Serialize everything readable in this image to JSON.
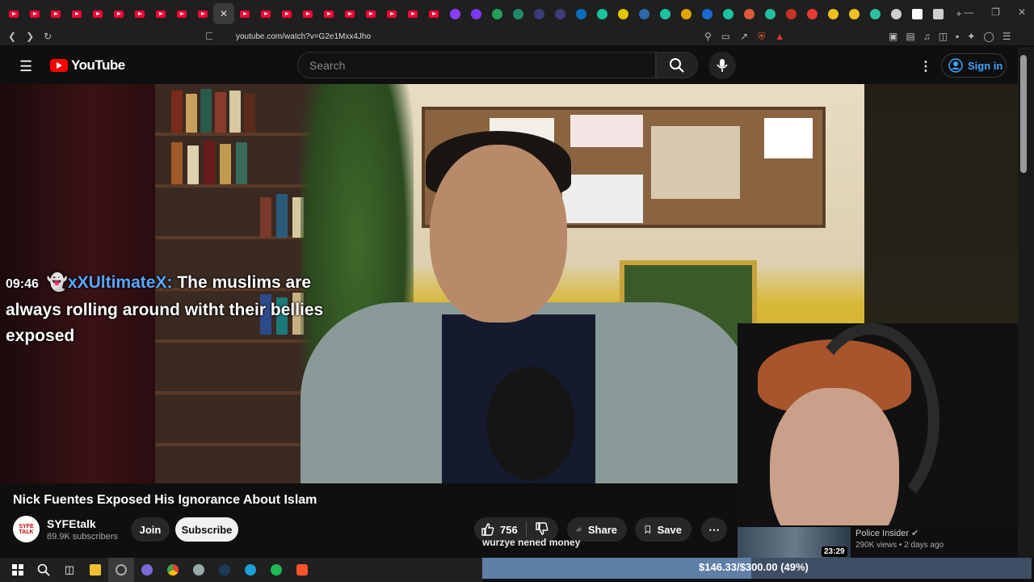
{
  "browser": {
    "url": "youtube.com/watch?v=G2e1Mxx4Jho",
    "active_tab_close": "✕",
    "new_tab": "+"
  },
  "youtube": {
    "logo_text": "YouTube",
    "search_placeholder": "Search",
    "sign_in": "Sign in"
  },
  "overlay_chat": {
    "time": "09:46",
    "username": "xXUltimateX:",
    "message": "The muslims are always rolling around witht their bellies exposed"
  },
  "video": {
    "title": "Nick Fuentes Exposed His Ignorance About Islam",
    "channel": "SYFEtalk",
    "avatar_text": "SYFE TALK",
    "subscribers": "89.9K subscribers",
    "join": "Join",
    "subscribe": "Subscribe",
    "likes": "756",
    "share": "Share",
    "save": "Save"
  },
  "recommended": {
    "duration": "23:29",
    "channel": "Police Insider",
    "meta": "290K views • 2 days ago"
  },
  "stream_overlay": {
    "caption": "wurzye nened money",
    "goal_text": "$146.33/$300.00 (49%)",
    "goal_fraction": 0.49
  },
  "colors": {
    "youtube_red": "#ff0000",
    "link_blue": "#3ea6ff",
    "chat_user": "#5aa7ff"
  }
}
